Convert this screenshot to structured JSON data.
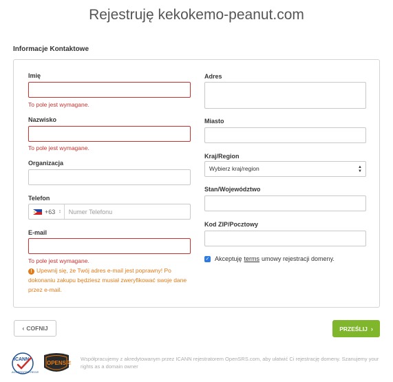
{
  "header": {
    "title": "Rejestruję kekokemo-peanut.com"
  },
  "section": {
    "title": "Informacje Kontaktowe"
  },
  "form": {
    "first_name": {
      "label": "Imię",
      "value": "",
      "error": "To pole jest wymagane."
    },
    "last_name": {
      "label": "Nazwisko",
      "value": "",
      "error": "To pole jest wymagane."
    },
    "organization": {
      "label": "Organizacja",
      "value": ""
    },
    "phone": {
      "label": "Telefon",
      "country_flag": "philippines-flag-icon",
      "country_code": "+63",
      "stepper_icon": "↕",
      "placeholder": "Numer Telefonu",
      "value": ""
    },
    "email": {
      "label": "E-mail",
      "value": "",
      "error": "To pole jest wymagane.",
      "warning_icon": "!",
      "warning": "Upewnij się, że Twój adres e-mail jest poprawny! Po dokonaniu zakupu będziesz musiał zweryfikować swoje dane przez e-mail."
    },
    "address": {
      "label": "Adres",
      "value": ""
    },
    "city": {
      "label": "Miasto",
      "value": ""
    },
    "country": {
      "label": "Kraj/Region",
      "selected": "Wybierz kraj/region"
    },
    "state": {
      "label": "Stan/Województwo",
      "value": ""
    },
    "zip": {
      "label": "Kod ZIP/Pocztowy",
      "value": ""
    },
    "terms": {
      "checked": true,
      "prefix": "Akceptuję",
      "link": "terms",
      "suffix": "umowy rejestracji domeny."
    }
  },
  "buttons": {
    "back": "COFNIJ",
    "back_icon": "‹",
    "submit": "PRZEŚLIJ",
    "submit_icon": "›"
  },
  "footer": {
    "text": "Współpracujemy z akredytowanym przez ICANN rejestratorem OpenSRS.com, aby ułatwić Ci rejestrację domeny. Szanujemy your rights as a domain owner",
    "logos": [
      "icann-accredited-registrar-logo",
      "opensrs-logo"
    ]
  },
  "colors": {
    "error": "#c9302c",
    "warning": "#e07b1a",
    "submit": "#7fb62c",
    "checkbox": "#2d7be0"
  }
}
